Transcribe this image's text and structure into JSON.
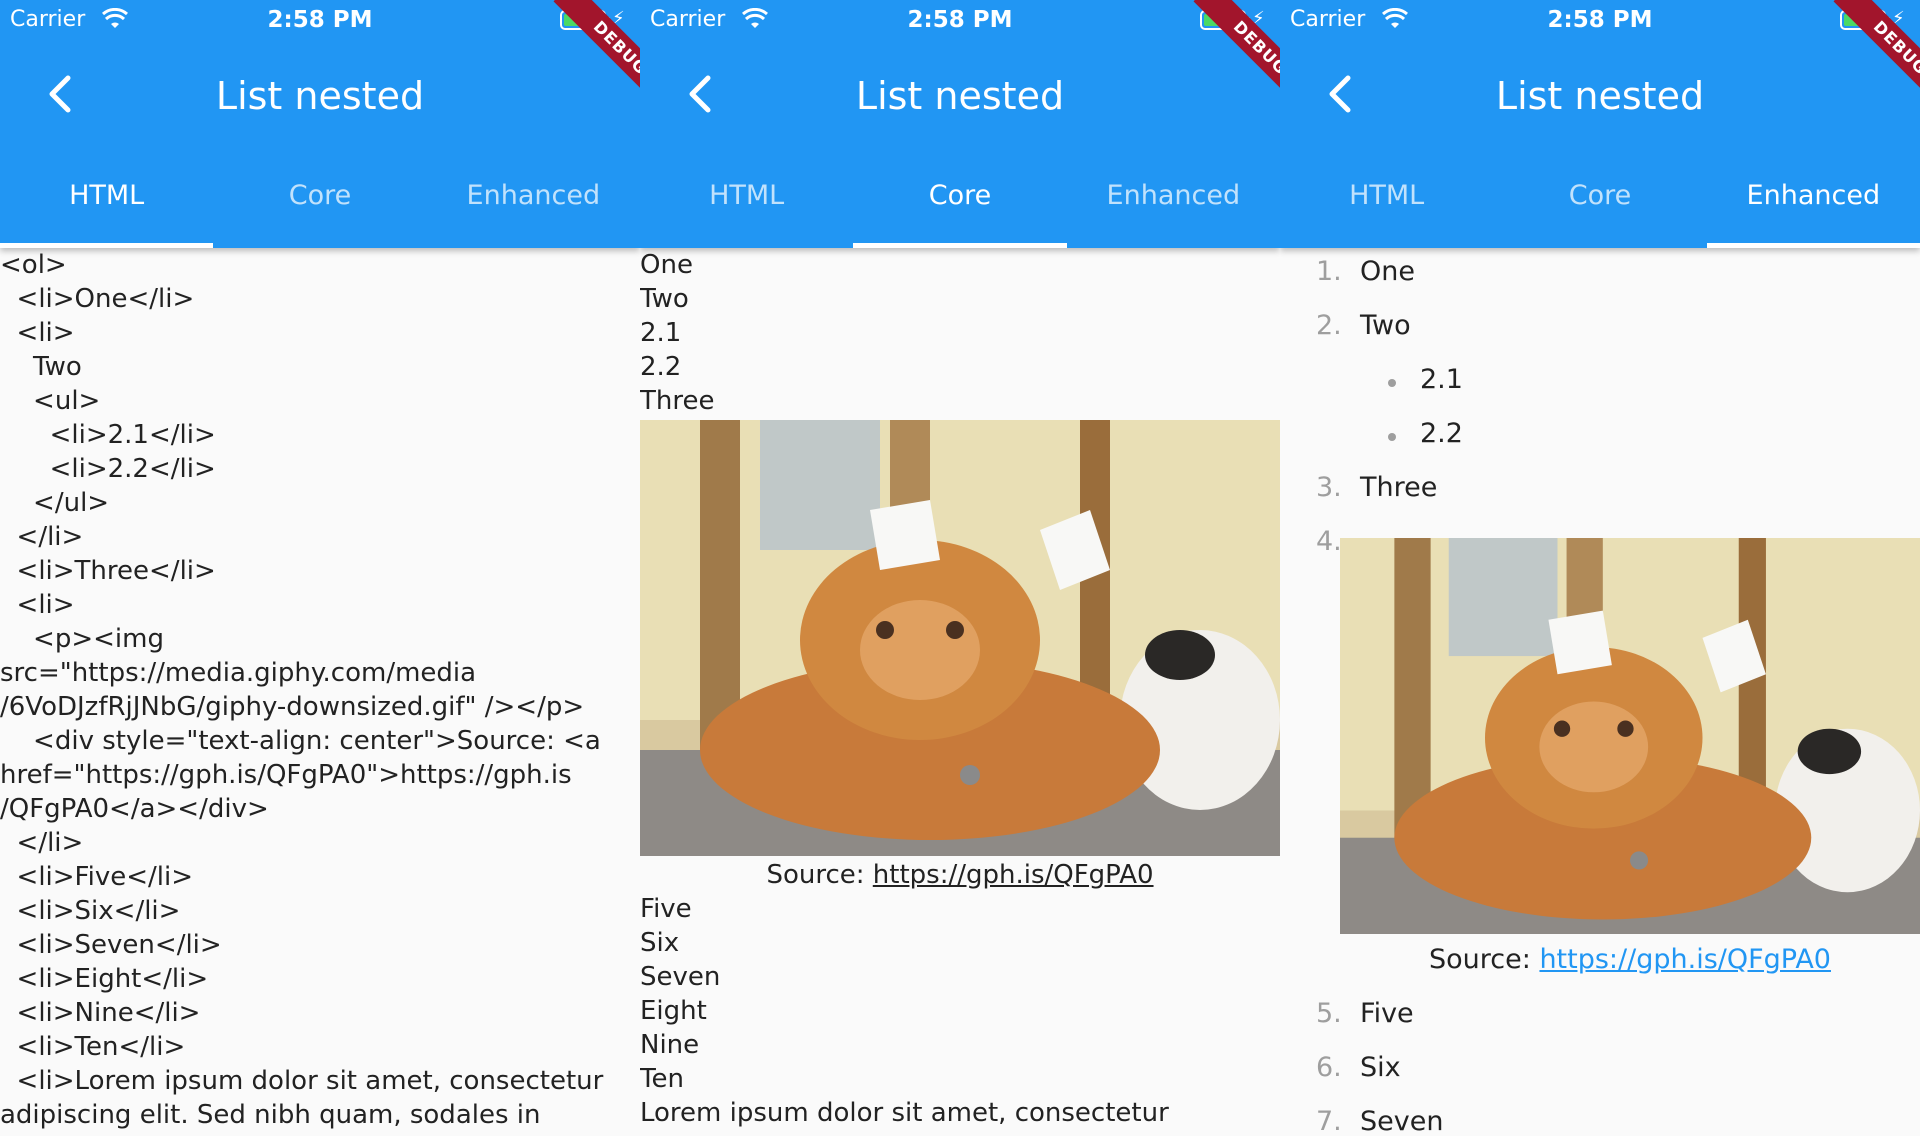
{
  "status": {
    "carrier": "Carrier",
    "time": "2:58 PM"
  },
  "title": "List nested",
  "debug_label": "DEBUG",
  "tabs": [
    "HTML",
    "Core",
    "Enhanced"
  ],
  "html_source": "<ol>\n  <li>One</li>\n  <li>\n    Two\n    <ul>\n      <li>2.1</li>\n      <li>2.2</li>\n    </ul>\n  </li>\n  <li>Three</li>\n  <li>\n    <p><img\nsrc=\"https://media.giphy.com/media\n/6VoDJzfRjJNbG/giphy-downsized.gif\" /></p>\n    <div style=\"text-align: center\">Source: <a\nhref=\"https://gph.is/QFgPA0\">https://gph.is\n/QFgPA0</a></div>\n  </li>\n  <li>Five</li>\n  <li>Six</li>\n  <li>Seven</li>\n  <li>Eight</li>\n  <li>Nine</li>\n  <li>Ten</li>\n  <li>Lorem ipsum dolor sit amet, consectetur\nadipiscing elit. Sed nibh quam, sodales in",
  "core": {
    "top_lines": [
      "One",
      "Two",
      "2.1",
      "2.2",
      "Three"
    ],
    "source_label": "Source: ",
    "source_link": "https://gph.is/QFgPA0",
    "bottom_lines": [
      "Five",
      "Six",
      "Seven",
      "Eight",
      "Nine",
      "Ten",
      "Lorem ipsum dolor sit amet, consectetur"
    ]
  },
  "enhanced": {
    "items": [
      {
        "num": "1.",
        "text": "One"
      },
      {
        "num": "2.",
        "text": "Two"
      },
      {
        "num": "3.",
        "text": "Three"
      },
      {
        "num": "4.",
        "text": ""
      },
      {
        "num": "5.",
        "text": "Five"
      },
      {
        "num": "6.",
        "text": "Six"
      },
      {
        "num": "7.",
        "text": "Seven"
      }
    ],
    "sub_items": [
      "2.1",
      "2.2"
    ],
    "source_label": "Source: ",
    "source_link": "https://gph.is/QFgPA0"
  },
  "colors": {
    "appbar": "#2196f3",
    "debug_banner": "#a2152c",
    "link": "#2196f3"
  }
}
